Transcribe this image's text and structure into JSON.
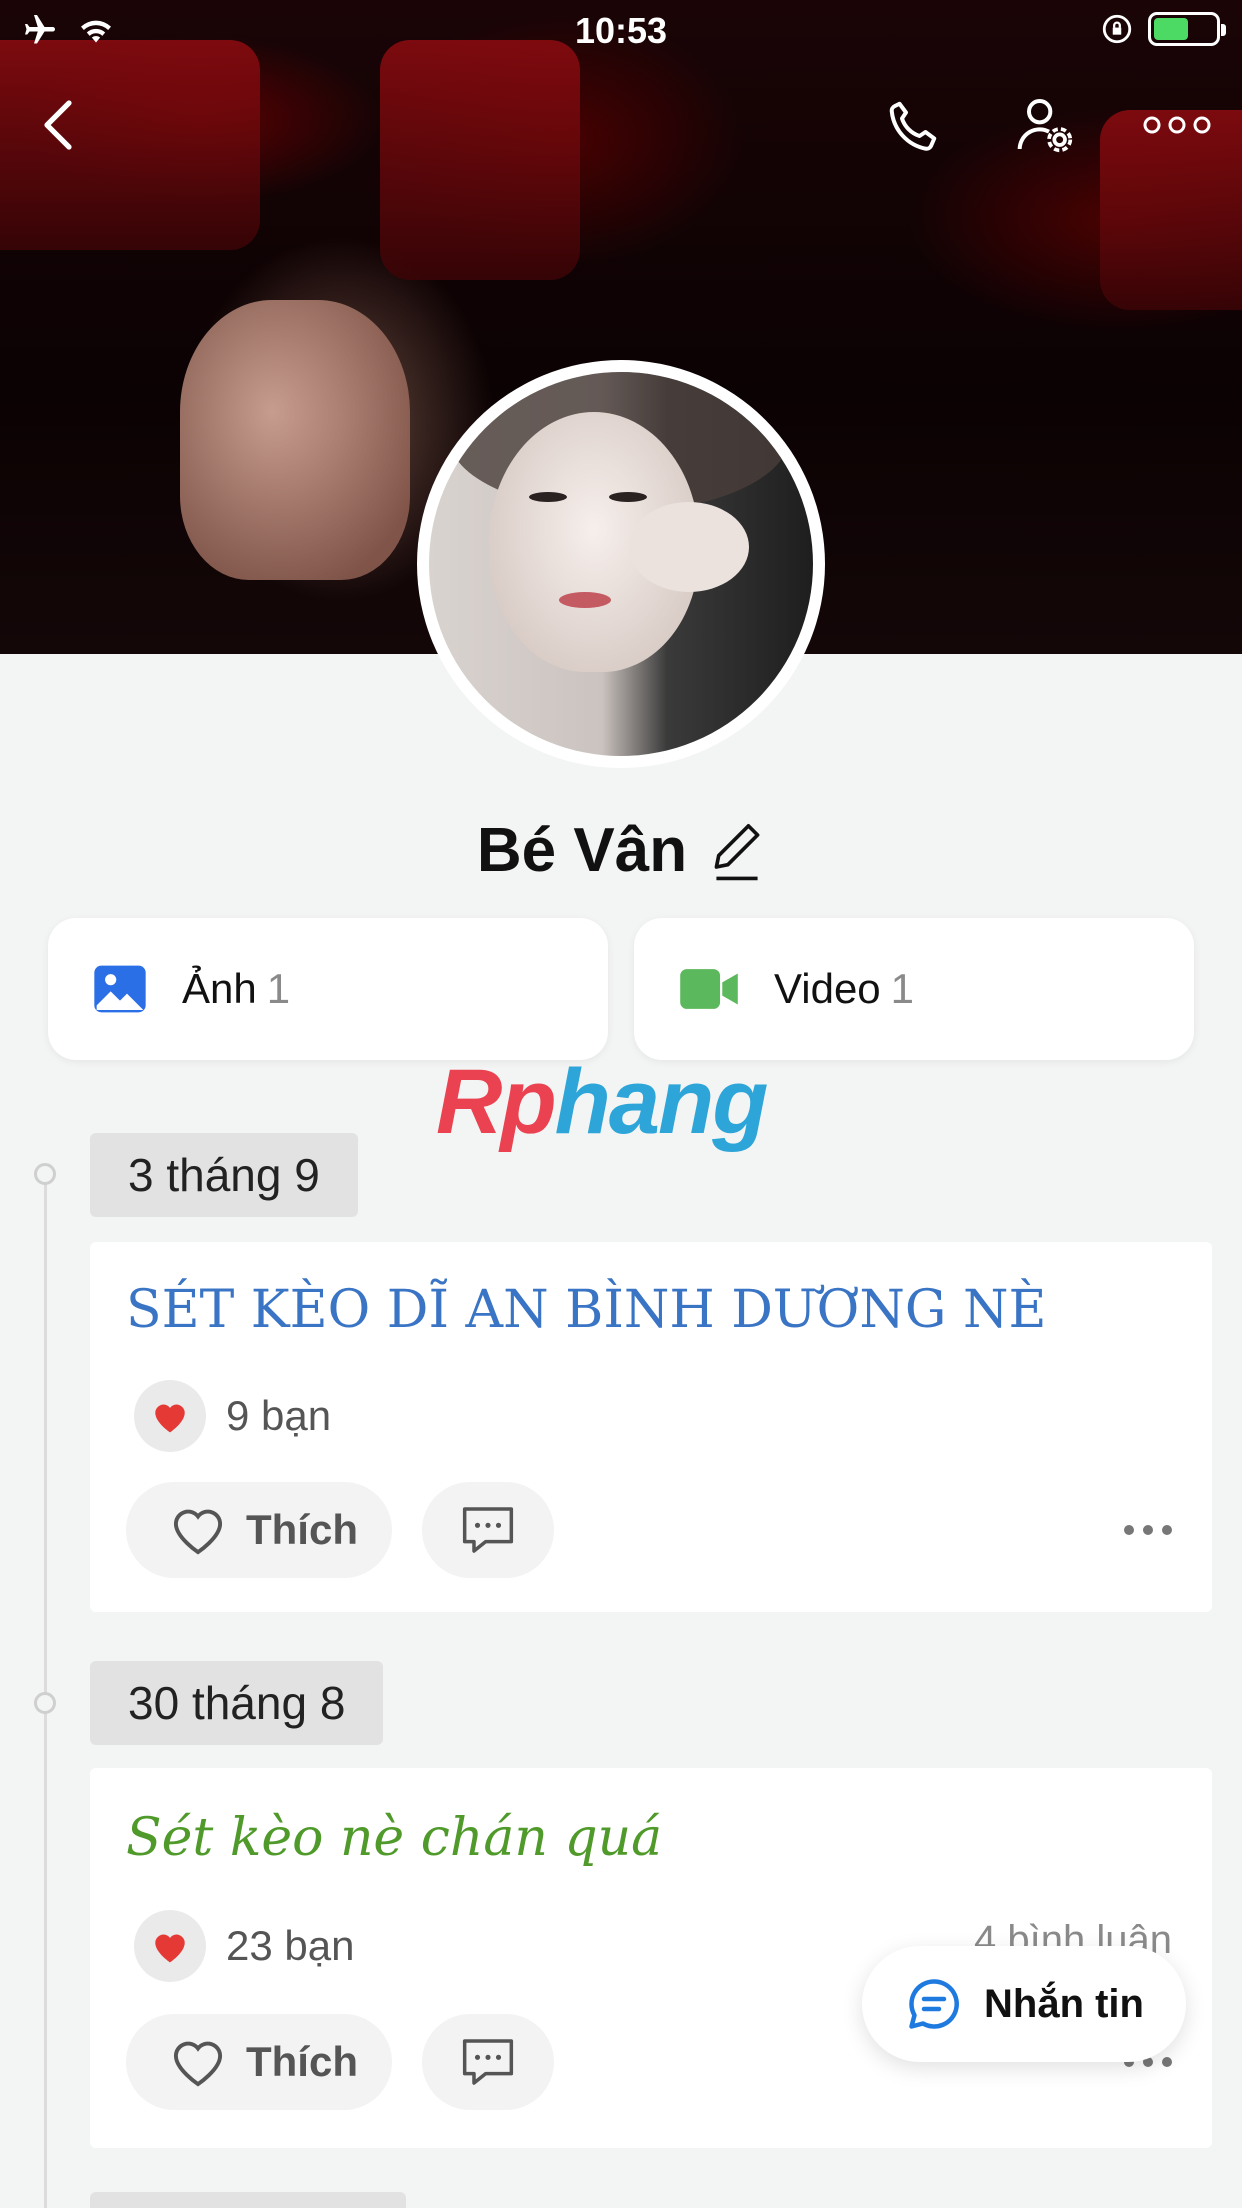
{
  "status_bar": {
    "time": "10:53",
    "icons": [
      "airplane-icon",
      "wifi-icon",
      "orientation-lock-icon",
      "battery-charging-icon"
    ],
    "battery_color": "#4cd964"
  },
  "topbar": {
    "back_icon": "chevron-left-icon",
    "call_icon": "phone-icon",
    "settings_icon": "user-settings-icon",
    "more_icon": "more-horizontal-icon"
  },
  "profile": {
    "name": "Bé Vân",
    "edit_icon": "pencil-icon"
  },
  "media": {
    "photos": {
      "label": "Ảnh",
      "count": "1",
      "icon": "image-icon",
      "color": "#2a6fe6"
    },
    "videos": {
      "label": "Video",
      "count": "1",
      "icon": "video-camera-icon",
      "color": "#5cb85c"
    }
  },
  "watermark": {
    "part1": "Rp",
    "part2": "hang"
  },
  "timeline": [
    {
      "date": "3 tháng 9",
      "post": {
        "text": "SÉT KÈO DĨ AN BÌNH DƯƠNG NÈ",
        "text_color": "#3a74c4",
        "reactions": "9 bạn",
        "comments": "",
        "like_label": "Thích"
      }
    },
    {
      "date": "30 tháng 8",
      "post": {
        "text": "Sét kèo nè chán quá",
        "text_color": "#4f9a2a",
        "reactions": "23 bạn",
        "comments": "4 bình luận",
        "like_label": "Thích"
      }
    }
  ],
  "message_button": {
    "label": "Nhắn tin",
    "icon": "chat-bubble-icon",
    "color": "#1f7ae0"
  }
}
